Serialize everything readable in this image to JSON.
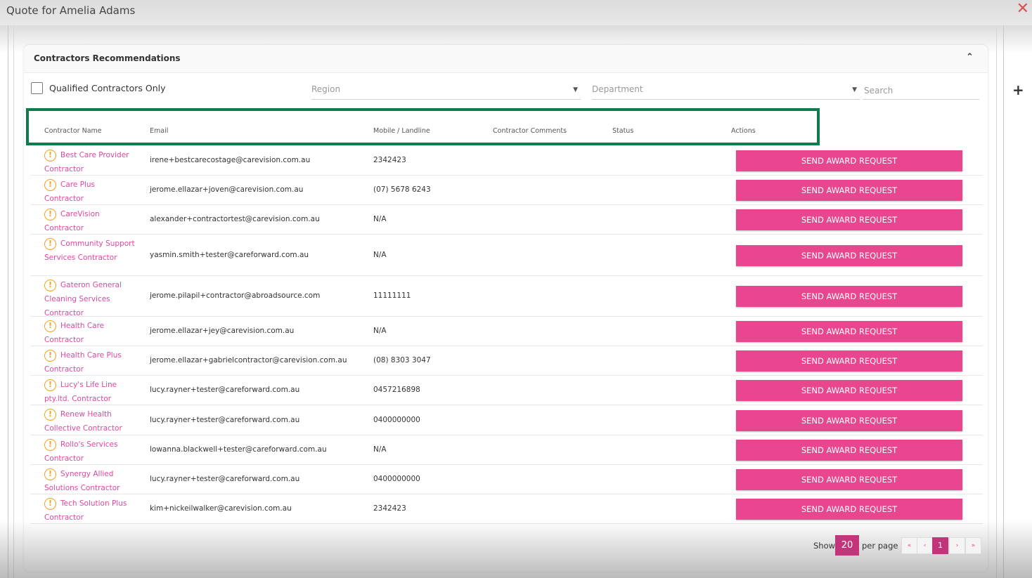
{
  "window": {
    "title": "Quote for Amelia Adams",
    "close_glyph": "✕",
    "plus_glyph": "+"
  },
  "panel": {
    "title": "Contractors Recommendations",
    "collapse_glyph": "⌃"
  },
  "filters": {
    "qualified_label": "Qualified Contractors Only",
    "region_placeholder": "Region",
    "department_placeholder": "Department",
    "search_placeholder": "Search",
    "caret_glyph": "▼"
  },
  "table": {
    "columns": [
      "Contractor Name",
      "Email",
      "Mobile / Landline",
      "Contractor Comments",
      "Status",
      "Actions"
    ],
    "action_label": "SEND AWARD REQUEST",
    "warn_glyph": "!",
    "rows": [
      {
        "name": "Best Care Provider Contractor",
        "email": "irene+bestcarecostage@carevision.com.au",
        "phone": "2342423"
      },
      {
        "name": "Care Plus Contractor",
        "email": "jerome.ellazar+joven@carevision.com.au",
        "phone": "(07) 5678 6243"
      },
      {
        "name": "CareVision Contractor",
        "email": "alexander+contractortest@carevision.com.au",
        "phone": "N/A"
      },
      {
        "name": "Community Support Services Contractor",
        "email": "yasmin.smith+tester@careforward.com.au",
        "phone": "N/A"
      },
      {
        "name": "Gateron General Cleaning Services Contractor",
        "email": "jerome.pilapil+contractor@abroadsource.com",
        "phone": "11111111"
      },
      {
        "name": "Health Care Contractor",
        "email": "jerome.ellazar+jey@carevision.com.au",
        "phone": "N/A"
      },
      {
        "name": "Health Care Plus Contractor",
        "email": "jerome.ellazar+gabrielcontractor@carevision.com.au",
        "phone": "(08) 8303 3047"
      },
      {
        "name": "Lucy's Life Line pty.ltd. Contractor",
        "email": "lucy.rayner+tester@careforward.com.au",
        "phone": "0457216898"
      },
      {
        "name": "Renew Health Collective Contractor",
        "email": "lucy.rayner+tester@careforward.com.au",
        "phone": "0400000000"
      },
      {
        "name": "Rollo's Services Contractor",
        "email": "lowanna.blackwell+tester@careforward.com.au",
        "phone": "N/A"
      },
      {
        "name": "Synergy Allied Solutions Contractor",
        "email": "lucy.rayner+tester@careforward.com.au",
        "phone": "0400000000"
      },
      {
        "name": "Tech Solution Plus Contractor",
        "email": "kim+nickeilwalker@carevision.com.au",
        "phone": "2342423"
      }
    ]
  },
  "pagination": {
    "show_label": "Show",
    "per_page_value": "20",
    "per_page_label": "per page",
    "first_glyph": "«",
    "prev_glyph": "‹",
    "current_page": "1",
    "next_glyph": "›",
    "last_glyph": "»"
  }
}
